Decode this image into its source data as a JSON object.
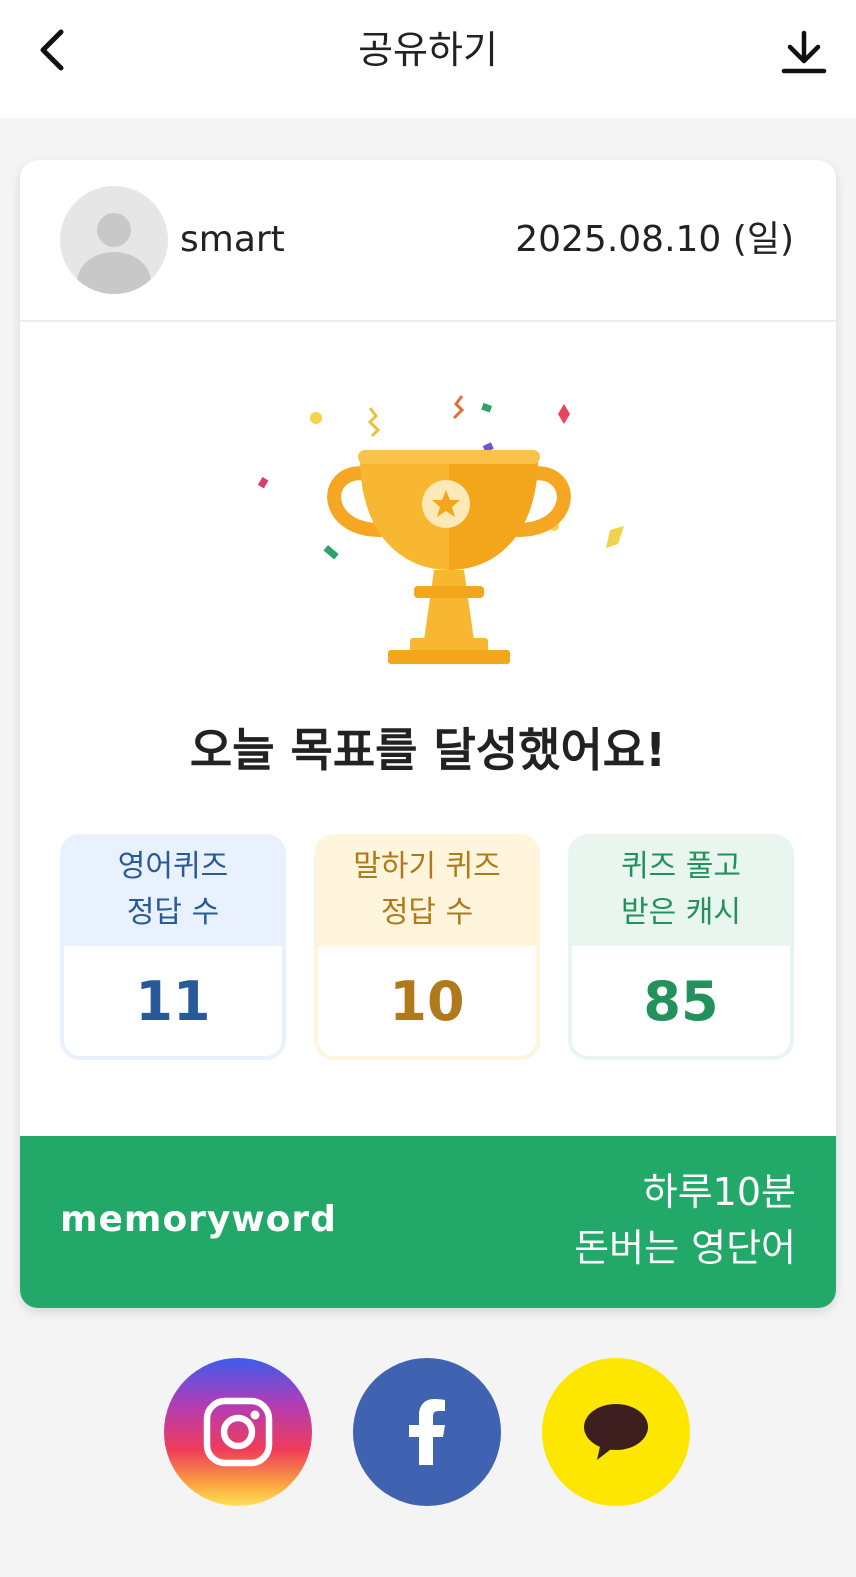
{
  "header": {
    "title": "공유하기",
    "back_icon": "chevron-left-icon",
    "download_icon": "download-icon"
  },
  "user": {
    "name": "smart",
    "date": "2025.08.10 (일)"
  },
  "achievement": {
    "headline": "오늘 목표를 달성했어요!"
  },
  "stats": [
    {
      "label_line1": "영어퀴즈",
      "label_line2": "정답 수",
      "value": "11",
      "color": "#285a9a"
    },
    {
      "label_line1": "말하기 퀴즈",
      "label_line2": "정답 수",
      "value": "10",
      "color": "#b07a1c"
    },
    {
      "label_line1": "퀴즈 풀고",
      "label_line2": "받은 캐시",
      "value": "85",
      "color": "#23915b"
    }
  ],
  "banner": {
    "brand": "memoryword",
    "tagline_line1": "하루10분",
    "tagline_line2": "돈버는 영단어",
    "color": "#22a868"
  },
  "share": [
    {
      "icon": "instagram-icon"
    },
    {
      "icon": "facebook-icon",
      "color": "#3f63b0"
    },
    {
      "icon": "kakaotalk-icon",
      "color": "#fde600"
    }
  ]
}
